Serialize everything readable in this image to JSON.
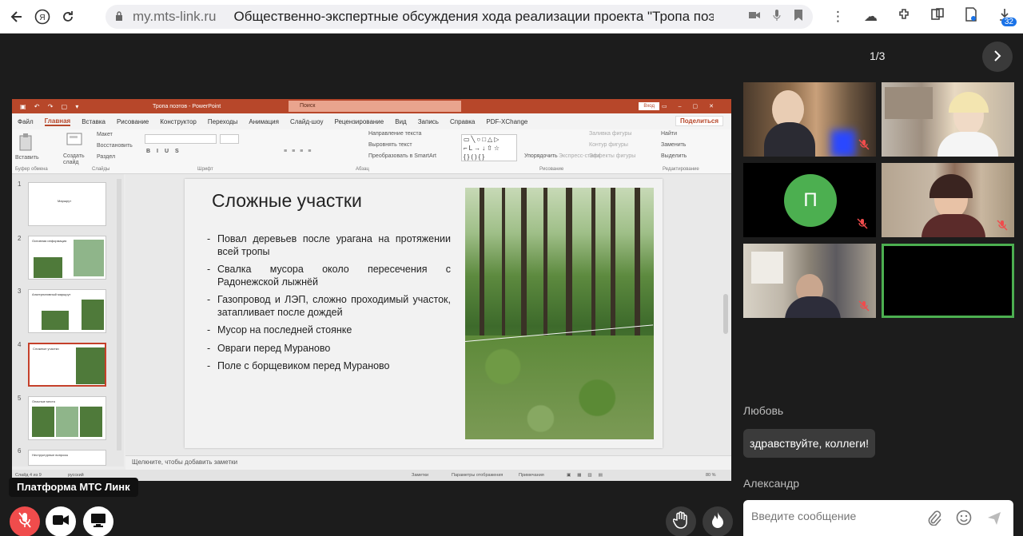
{
  "browser": {
    "domain": "my.mts-link.ru",
    "tab_title": "Общественно-экспертные обсуждения хода реализации проекта \"Тропа поэтов...",
    "extensions_badge": "32"
  },
  "presentation": {
    "app_title": "Тропа поэтов - PowerPoint",
    "search_placeholder": "Поиск",
    "login_label": "Вход",
    "share_label": "Поделиться",
    "tabs": [
      "Файл",
      "Главная",
      "Вставка",
      "Рисование",
      "Конструктор",
      "Переходы",
      "Анимация",
      "Слайд-шоу",
      "Рецензирование",
      "Вид",
      "Запись",
      "Справка",
      "PDF-XChange"
    ],
    "ribbon_groups": [
      "Буфер обмена",
      "Слайды",
      "Шрифт",
      "Абзац",
      "Рисование",
      "Редактирование"
    ],
    "ribbon_items": {
      "paste": "Вставить",
      "create_slide": "Создать слайд",
      "layout": "Макет",
      "reset": "Восстановить",
      "section": "Раздел",
      "arrange": "Упорядочить",
      "quick_styles": "Экспресс-стили",
      "shape_fill": "Заливка фигуры",
      "shape_outline": "Контур фигуры",
      "shape_effects": "Эффекты фигуры",
      "find": "Найти",
      "replace": "Заменить",
      "select": "Выделить",
      "text_direction": "Направление текста",
      "align_text": "Выровнять текст",
      "smartart": "Преобразовать в SmartArt"
    },
    "thumb_numbers": [
      "1",
      "2",
      "3",
      "4",
      "5",
      "6"
    ],
    "thumb_titles": [
      "Маршрут",
      "Основная информация",
      "Альтернативный маршрут",
      "Сложные участки",
      "Опасные места",
      "Неструктурные вопросы"
    ],
    "slide": {
      "title": "Сложные участки",
      "bullets": [
        "Повал деревьев после урагана на протяжении всей тропы",
        "Свалка мусора около пересечения с Радонежской лыжнёй",
        "Газопровод и ЛЭП, сложно проходимый участок, затапливает после дождей",
        "Мусор на последней стоянке",
        "Овраги перед Мураново",
        "Поле с борщевиком перед Мураново"
      ]
    },
    "notes_placeholder": "Щелкните, чтобы добавить заметки",
    "status": {
      "slide_counter": "Слайд 4 из 9",
      "language": "русский",
      "notes": "Заметки",
      "display_settings": "Параметры отображения",
      "comments": "Примечания",
      "zoom": "80 %"
    }
  },
  "brand_badge": "Платформа МТС Линк",
  "controls": {
    "mic": "mic-off",
    "camera": "camera",
    "screen_share": "screen-share",
    "raise_hand": "raise-hand",
    "reactions": "fire"
  },
  "participants": {
    "page_indicator": "1/3",
    "avatar_letter": "П"
  },
  "chat": {
    "messages": [
      {
        "author": "Любовь",
        "text": "здравствуйте, коллеги!"
      },
      {
        "author": "Александр",
        "text": ""
      }
    ],
    "input_placeholder": "Введите сообщение"
  },
  "colors": {
    "mute_red": "#f04c4c",
    "active_speaker": "#4caf50",
    "ppt_accent": "#b7472a"
  }
}
